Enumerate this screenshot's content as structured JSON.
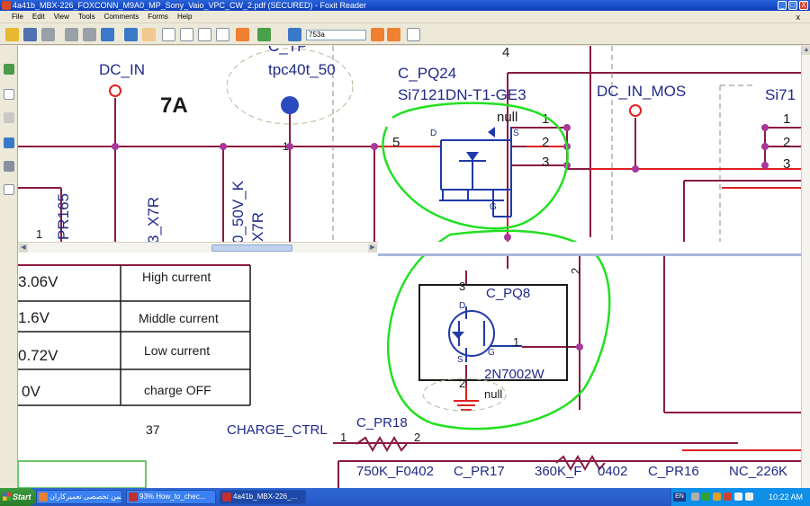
{
  "window": {
    "title": "4a41b_MBX-226_FOXCONN_M9A0_MP_Sony_Vaio_VPC_CW_2.pdf (SECURED) - Foxit Reader",
    "minimize": "_",
    "maximize": "□",
    "close": "X"
  },
  "menu": {
    "items": [
      "File",
      "Edit",
      "View",
      "Tools",
      "Comments",
      "Forms",
      "Help"
    ],
    "close_doc": "x"
  },
  "toolbar": {
    "search_value": "753a"
  },
  "schematic_top": {
    "net_dc_in": "DC_IN",
    "current_7a": "7A",
    "tp_label": "tpc40t_50",
    "tp_fragment": "C_TP",
    "q24_ref": "C_PQ24",
    "q24_part": "Si7121DN-T1-GE3",
    "null_label": "null",
    "pin_5": "5",
    "pin_d": "D",
    "pin_s": "S",
    "pin_g": "G",
    "pin_1": "1",
    "pin_2": "2",
    "pin_3": "3",
    "pin_4": "4",
    "net_dc_in_mos": "DC_IN_MOS",
    "si71_fragment": "Si71",
    "r_pr165": "PR165",
    "r_x7r": "3_X7R",
    "cap_50v": "0_50V_K",
    "cap_x7r2": "X7R",
    "pin_1_left": "1",
    "pin_1_far": "1",
    "pin_1_bot": "1"
  },
  "schematic_bottom": {
    "voltages": [
      "3.06V",
      "1.6V",
      "0.72V",
      "0V"
    ],
    "modes": [
      "High current",
      "Middle current",
      "Low current",
      "charge OFF"
    ],
    "page_num": "37",
    "q8_ref": "C_PQ8",
    "q8_part": "2N7002W",
    "q8_null": "null",
    "q8_d": "D",
    "q8_s": "S",
    "q8_g": "G",
    "q8_pin3": "3",
    "q8_pin2": "2",
    "q8_pin1": "1",
    "net_2": "2",
    "charge_ctrl": "CHARGE_CTRL",
    "pr18": "C_PR18",
    "pr18_pin1": "1",
    "pr18_pin2": "2",
    "r750k": "750K_F0402",
    "pr17": "C_PR17",
    "r360k": "360K_F",
    "r0402": "0402",
    "pr16": "C_PR16",
    "nc226k": "NC_226K"
  },
  "taskbar": {
    "start": "Start",
    "tasks": [
      "انجمن تخصصی تعمیرکاران",
      "93% How_to_chec...",
      "4a41b_MBX-226_..."
    ],
    "lang": "EN",
    "clock": "10:22 AM"
  },
  "colors": {
    "wire": "#8b1a40",
    "node": "#a8389a",
    "text": "#1f2a8a",
    "red_wire": "#e02020",
    "highlight": "#22e022"
  }
}
